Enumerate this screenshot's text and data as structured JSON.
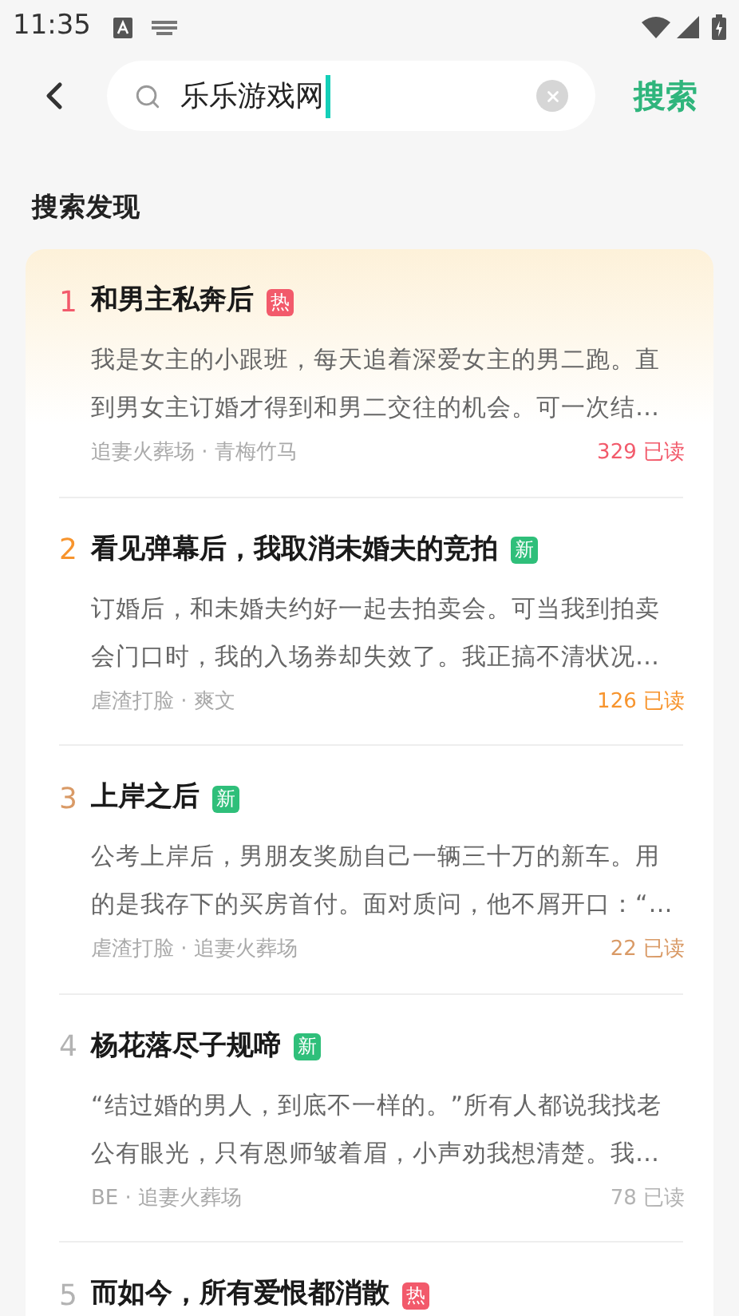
{
  "status_bar": {
    "time": "11:35"
  },
  "search": {
    "value": "乐乐游戏网",
    "button": "搜索"
  },
  "section_title": "搜索发现",
  "items": [
    {
      "rank": "1",
      "color": "#f25a6b",
      "title": "和男主私奔后",
      "tag": {
        "kind": "hot",
        "label": "热"
      },
      "description": "我是女主的小跟班，每天追着深爱女主的男二跑。直到男女主订婚才得到和男二交往的机会。可一次结…",
      "tags": "追妻火葬场 · 青梅竹马",
      "reads": "329 已读"
    },
    {
      "rank": "2",
      "color": "#f7942d",
      "title": "看见弹幕后，我取消未婚夫的竞拍",
      "tag": {
        "kind": "new",
        "label": "新"
      },
      "description": "订婚后，和未婚夫约好一起去拍卖会。可当我到拍卖会门口时，我的入场券却失效了。我正搞不清状况…",
      "tags": "虐渣打脸 · 爽文",
      "reads": "126 已读"
    },
    {
      "rank": "3",
      "color": "#d99a66",
      "title": "上岸之后",
      "tag": {
        "kind": "new",
        "label": "新"
      },
      "description": "公考上岸后，男朋友奖励自己一辆三十万的新车。用的是我存下的买房首付。面对质问，他不屑开口：“…",
      "tags": "虐渣打脸 · 追妻火葬场",
      "reads": "22 已读"
    },
    {
      "rank": "4",
      "color": "#b3b3b3",
      "title": "杨花落尽子规啼",
      "tag": {
        "kind": "new",
        "label": "新"
      },
      "description": "“结过婚的男人，到底不一样的。”所有人都说我找老公有眼光，只有恩师皱着眉，小声劝我想清楚。我…",
      "tags": "BE · 追妻火葬场",
      "reads": "78 已读"
    },
    {
      "rank": "5",
      "color": "#b3b3b3",
      "title": "而如今，所有爱恨都消散",
      "tag": {
        "kind": "hot",
        "label": "热"
      }
    }
  ]
}
